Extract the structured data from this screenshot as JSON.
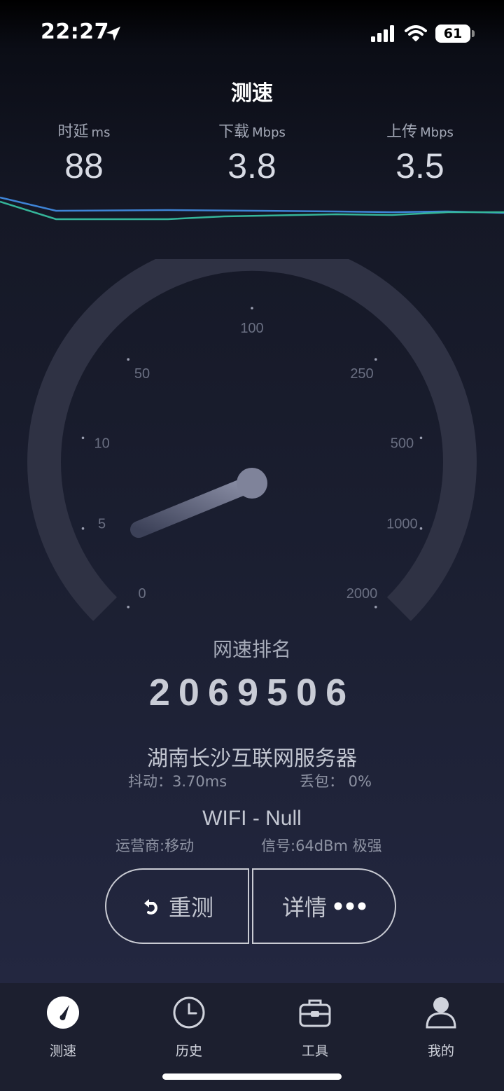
{
  "status_bar": {
    "time": "22:27",
    "battery": "61"
  },
  "header": {
    "title": "测速"
  },
  "metrics": [
    {
      "label": "时延",
      "unit": "ms",
      "value": "88"
    },
    {
      "label": "下载",
      "unit": "Mbps",
      "value": "3.8"
    },
    {
      "label": "上传",
      "unit": "Mbps",
      "value": "3.5"
    }
  ],
  "gauge": {
    "ticks": [
      "0",
      "5",
      "10",
      "50",
      "100",
      "250",
      "500",
      "1000",
      "2000"
    ],
    "needle_value_mbps": 3.8
  },
  "ranking": {
    "label": "网速排名",
    "value": "2069506"
  },
  "server": {
    "name": "湖南长沙互联网服务器",
    "jitter": "抖动：3.70ms",
    "loss": "丢包： 0%"
  },
  "network": {
    "type": "WIFI - Null",
    "carrier": "运营商:移动",
    "signal": "信号:64dBm 极强"
  },
  "actions": {
    "retest": "重测",
    "details": "详情"
  },
  "tabs": [
    {
      "label": "测速",
      "icon": "speedometer-icon",
      "active": true
    },
    {
      "label": "历史",
      "icon": "clock-icon",
      "active": false
    },
    {
      "label": "工具",
      "icon": "toolbox-icon",
      "active": false
    },
    {
      "label": "我的",
      "icon": "person-icon",
      "active": false
    }
  ],
  "colors": {
    "download_line": "#3e84d6",
    "upload_line": "#35b59a",
    "gauge_track": "#2f3244"
  }
}
